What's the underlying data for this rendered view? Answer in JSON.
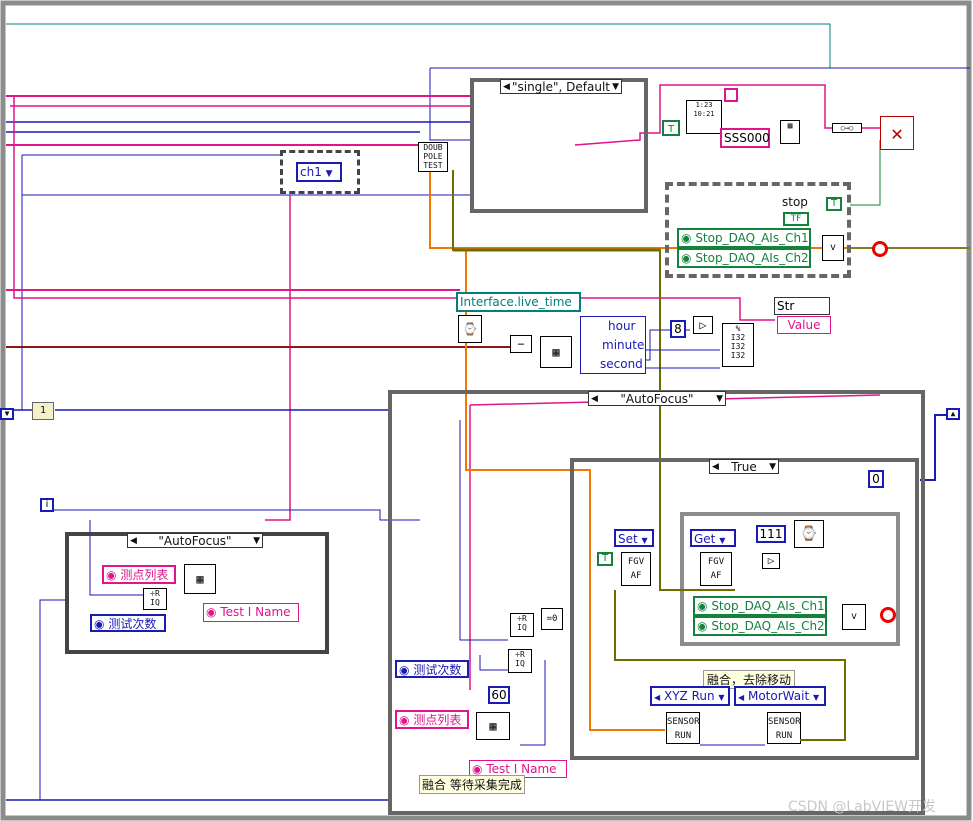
{
  "structures": {
    "top_case": "\"single\", Default",
    "main_case": "\"AutoFocus\"",
    "left_case": "\"AutoFocus\"",
    "inner_case": "True"
  },
  "constants": {
    "channel": "ch1",
    "format_string": "SSS000",
    "iter_const": "1",
    "num_8": "8",
    "num_60": "60",
    "num_0": "0",
    "num_111": "111",
    "loop_index": "i"
  },
  "labels": {
    "stop_label": "stop",
    "stop_tf": "TF",
    "local_var": "Interface.live_time",
    "str_out": "Str",
    "value_out": "Value",
    "hour": "hour",
    "minute": "minute",
    "second": "second",
    "fusion_move": "融合，去除移动",
    "fusion_wait": "融合 等待采集完成"
  },
  "properties": {
    "stop_ch1": "Stop_DAQ_AIs_Ch1",
    "stop_ch2": "Stop_DAQ_AIs_Ch2",
    "stop_ch1_b": "Stop_DAQ_AIs_Ch1",
    "stop_ch2_b": "Stop_DAQ_AIs_Ch2",
    "points_list_left": "测点列表",
    "test_count_left": "测试次数",
    "test_name_left": "Test I Name",
    "test_count_main": "测试次数",
    "points_list_main": "测点列表",
    "test_name_main": "Test I Name"
  },
  "enums": {
    "set": "Set",
    "get": "Get",
    "xyz_run": "XYZ Run",
    "motor_wait": "MotorWait"
  },
  "subvis": {
    "double_pole": "DOUB POLE TEST",
    "fgv_af_1": "FGV AF",
    "fgv_af_2": "FGV AF",
    "sensor_run_1": "SENSOR RUN",
    "sensor_run_2": "SENSOR RUN"
  },
  "bool_consts": {
    "t1": "T",
    "t2": "T",
    "t3": "T"
  },
  "watermark": "CSDN @LabVIEW开发",
  "colors": {
    "frame_gray": "#8c8c8c",
    "wire_blue": "#1a1ab4",
    "wire_pink": "#e0148c",
    "wire_orange": "#f07800",
    "wire_green": "#14823c",
    "wire_teal": "#008080",
    "wire_olive": "#6e6e00"
  }
}
